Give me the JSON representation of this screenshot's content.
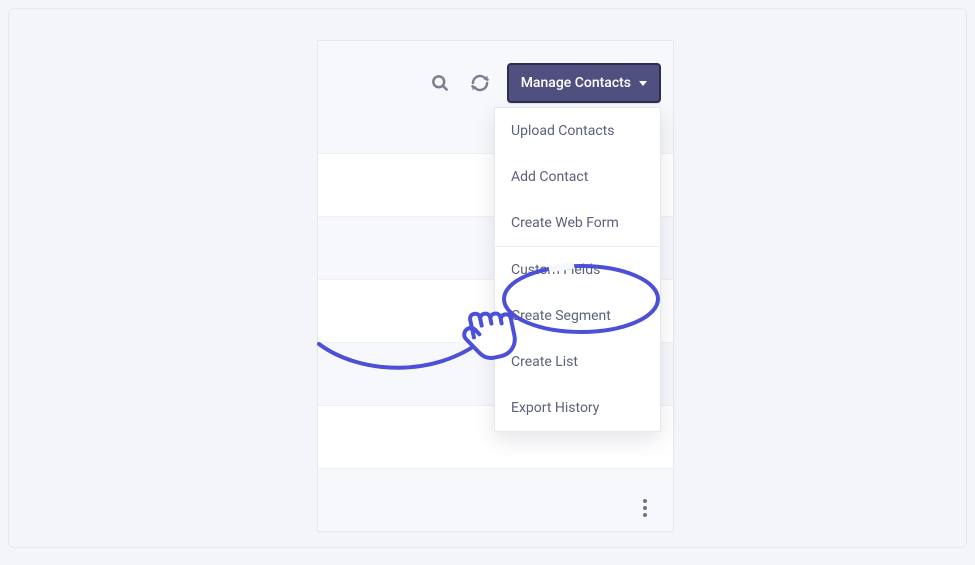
{
  "toolbar": {
    "manage_label": "Manage Contacts"
  },
  "dropdown": {
    "items": [
      "Upload Contacts",
      "Add Contact",
      "Create Web Form",
      "Custom Fields",
      "Create Segment",
      "Create List",
      "Export History"
    ]
  },
  "annotation": {
    "highlight_target": "Custom Fields",
    "color": "#4c4fd8"
  }
}
